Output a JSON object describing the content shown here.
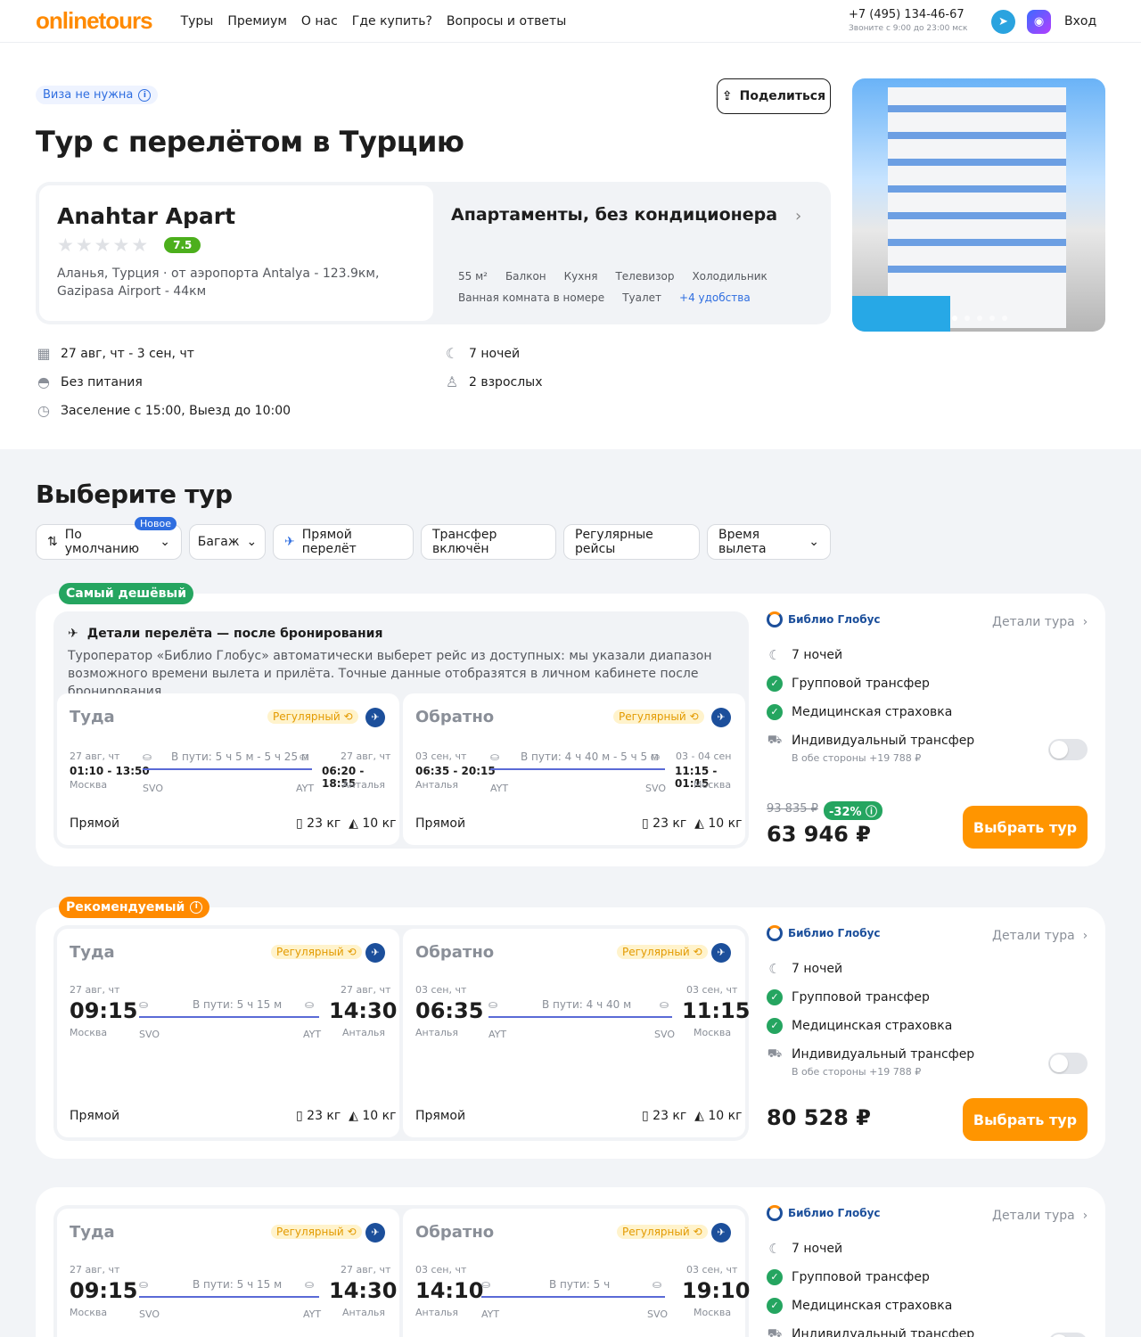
{
  "header": {
    "logo": "onlinetours",
    "nav": [
      "Туры",
      "Премиум",
      "О нас",
      "Где купить?",
      "Вопросы и ответы"
    ],
    "phone": "+7 (495) 134-46-67",
    "phone_hours": "Звоните с 9:00 до 23:00 мск",
    "login": "Вход"
  },
  "visa_badge": "Виза не нужна",
  "share_label": "Поделиться",
  "title": "Тур с перелётом в Турцию",
  "hotel": {
    "name": "Anahtar Apart",
    "rating": "7.5",
    "location": "Аланья, Турция · от аэропорта Antalya - 123.9км, Gazipasa Airport - 44км"
  },
  "room": {
    "name": "Апартаменты, без кондиционера",
    "amenities": [
      "55 м²",
      "Балкон",
      "Кухня",
      "Телевизор",
      "Холодильник",
      "Ванная комната в номере",
      "Туалет"
    ],
    "more": "+4 удобства"
  },
  "trip": {
    "dates": "27 авг, чт - 3 сен, чт",
    "meals": "Без питания",
    "checkin": "Заселение с 15:00, Выезд до 10:00",
    "nights": "7 ночей",
    "guests": "2 взрослых"
  },
  "select_title": "Выберите тур",
  "filters": {
    "sort": "По умолчанию",
    "new_tag": "Новое",
    "baggage": "Багаж",
    "direct": "Прямой перелёт",
    "transfer": "Трансфер включён",
    "regular": "Регулярные рейсы",
    "time": "Время вылета"
  },
  "common": {
    "there": "Туда",
    "back": "Обратно",
    "regular": "Регулярный",
    "direct": "Прямой",
    "bag": "23 кг",
    "hand": "10 кг",
    "operator": "Библио Глобус",
    "details": "Детали тура",
    "nights": "7 ночей",
    "group_transfer": "Групповой трансфер",
    "insurance": "Медицинская страховка",
    "ind_transfer": "Индивидуальный трансфер",
    "ind_transfer_price": "В обе стороны +19 788 ₽",
    "select": "Выбрать тур",
    "moscow": "Москва",
    "antalya": "Анталья",
    "svo": "SVO",
    "ayt": "AYT"
  },
  "offer1": {
    "badge": "Самый дешёвый",
    "details_title": "Детали перелёта — после бронирования",
    "details_text": "Туроператор «Библио Глобус» автоматически выберет рейс из доступных: мы указали диапазон возможного времени вылета и прилёта. Точные данные отобразятся в личном кабинете после бронирования.",
    "out": {
      "dep_date": "27 авг, чт",
      "dep_time": "01:10 - 13:50",
      "duration": "В пути: 5 ч 5 м - 5 ч 25 м",
      "arr_date": "27 авг, чт",
      "arr_time": "06:20 - 18:55"
    },
    "ret": {
      "dep_date": "03 сен, чт",
      "dep_time": "06:35 - 20:15",
      "duration": "В пути: 4 ч 40 м - 5 ч 5 м",
      "arr_date": "03 - 04 сен",
      "arr_time": "11:15 - 01:15"
    },
    "old_price": "93 835 ₽",
    "discount": "-32%",
    "price": "63 946 ₽"
  },
  "offer2": {
    "badge": "Рекомендуемый",
    "out": {
      "dep_date": "27 авг, чт",
      "dep_time": "09:15",
      "duration": "В пути: 5 ч 15 м",
      "arr_date": "27 авг, чт",
      "arr_time": "14:30"
    },
    "ret": {
      "dep_date": "03 сен, чт",
      "dep_time": "06:35",
      "duration": "В пути: 4 ч 40 м",
      "arr_date": "03 сен, чт",
      "arr_time": "11:15"
    },
    "price": "80 528 ₽"
  },
  "offer3": {
    "out": {
      "dep_date": "27 авг, чт",
      "dep_time": "09:15",
      "duration": "В пути: 5 ч 15 м",
      "arr_date": "27 авг, чт",
      "arr_time": "14:30"
    },
    "ret": {
      "dep_date": "03 сен, чт",
      "dep_time": "14:10",
      "duration": "В пути: 5 ч",
      "arr_date": "03 сен, чт",
      "arr_time": "19:10"
    }
  }
}
